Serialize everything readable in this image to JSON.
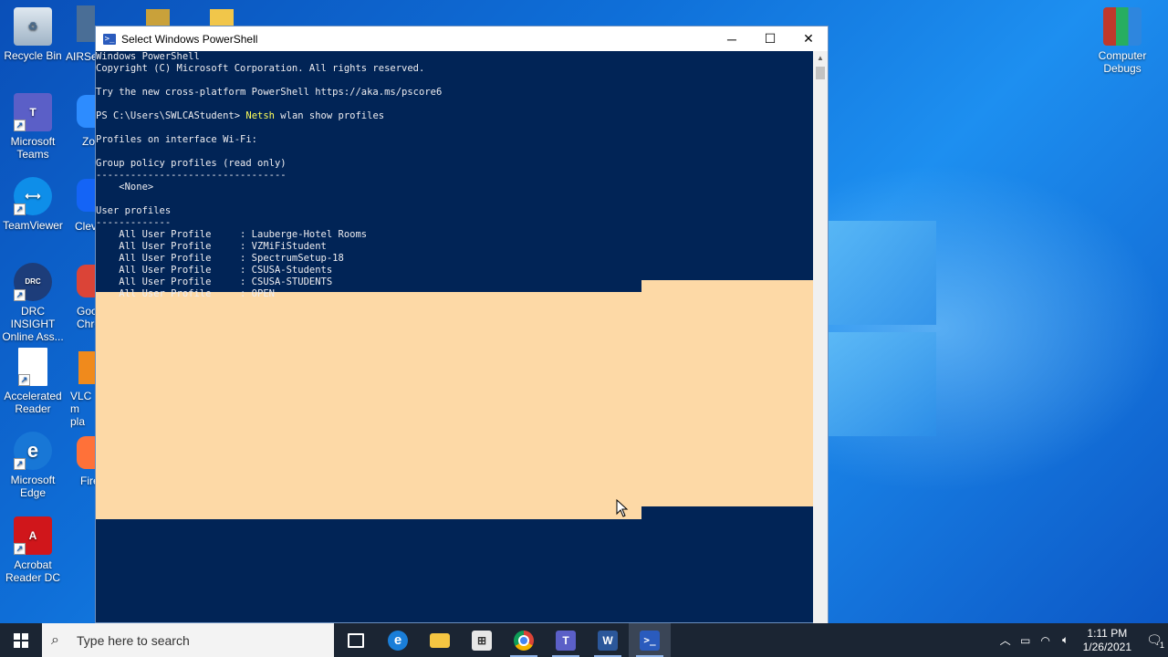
{
  "desktop": {
    "icons": [
      {
        "label": "Recycle Bin",
        "icon": "recycle-bin-icon"
      },
      {
        "label": "Microsoft Teams",
        "icon": "teams-icon"
      },
      {
        "label": "TeamViewer",
        "icon": "teamviewer-icon"
      },
      {
        "label": "DRC INSIGHT Online Ass...",
        "icon": "drc-insight-icon"
      },
      {
        "label": "Accelerated Reader",
        "icon": "document-icon"
      },
      {
        "label": "Microsoft Edge",
        "icon": "edge-icon"
      },
      {
        "label": "Acrobat Reader DC",
        "icon": "acrobat-icon"
      }
    ],
    "partial_labels": [
      "AIRSec",
      "Zo",
      "Clev",
      "Goo Chro",
      "VLC m pla",
      "Fire"
    ],
    "right_icon": {
      "label": "Computer Debugs",
      "icon": "winrar-icon"
    }
  },
  "window": {
    "title": "Select Windows PowerShell",
    "minimize": "─",
    "maximize": "☐",
    "close": "✕",
    "console_lines": [
      {
        "text": "Windows PowerShell"
      },
      {
        "text": "Copyright (C) Microsoft Corporation. All rights reserved."
      },
      {
        "text": ""
      },
      {
        "text": "Try the new cross-platform PowerShell https://aka.ms/pscore6"
      },
      {
        "text": ""
      },
      {
        "prompt": "PS C:\\Users\\SWLCAStudent> ",
        "cmd": "Netsh",
        "args": " wlan show profiles"
      },
      {
        "text": ""
      },
      {
        "text": "Profiles on interface Wi-Fi:"
      },
      {
        "text": ""
      },
      {
        "text": "Group policy profiles (read only)"
      },
      {
        "text": "---------------------------------"
      },
      {
        "text": "    <None>"
      },
      {
        "text": ""
      },
      {
        "text": "User profiles"
      },
      {
        "text": "-------------"
      },
      {
        "text": "    All User Profile     : Lauberge-Hotel Rooms"
      },
      {
        "text": "    All User Profile     : VZMiFiStudent"
      },
      {
        "text": "    All User Profile     : SpectrumSetup-18"
      },
      {
        "text": "    All User Profile     : CSUSA-Students"
      },
      {
        "text": "    All User Profile     : CSUSA-STUDENTS"
      },
      {
        "text": "    All User Profile     : OPEN"
      }
    ],
    "selection_color": "#fdd9a6",
    "background_color": "#012456"
  },
  "taskbar": {
    "search_placeholder": "Type here to search",
    "apps": [
      {
        "name": "task-view",
        "icon": "task-view-icon"
      },
      {
        "name": "edge",
        "icon": "edge-icon"
      },
      {
        "name": "file-explorer",
        "icon": "folder-icon"
      },
      {
        "name": "microsoft-store",
        "icon": "store-icon"
      },
      {
        "name": "chrome",
        "icon": "chrome-icon"
      },
      {
        "name": "teams",
        "icon": "teams-icon"
      },
      {
        "name": "word",
        "icon": "word-icon"
      },
      {
        "name": "powershell",
        "icon": "powershell-icon"
      }
    ],
    "clock_time": "1:11 PM",
    "clock_date": "1/26/2021",
    "notification_count": "1"
  }
}
